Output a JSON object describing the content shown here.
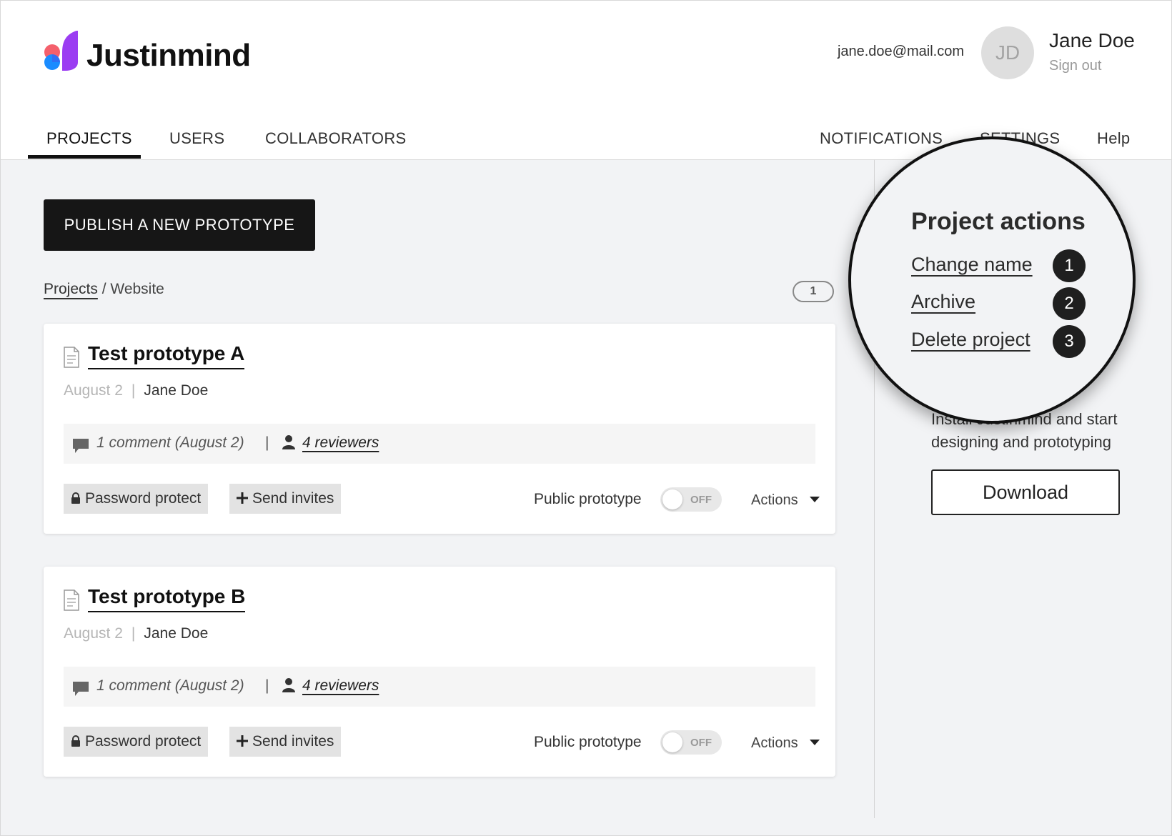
{
  "brand": {
    "name": "Justinmind"
  },
  "user": {
    "email": "jane.doe@mail.com",
    "initials": "JD",
    "name": "Jane Doe",
    "sign_out": "Sign out"
  },
  "nav": {
    "tabs": [
      {
        "label": "PROJECTS",
        "active": true
      },
      {
        "label": "USERS"
      },
      {
        "label": "COLLABORATORS"
      }
    ],
    "right_tabs": [
      {
        "label": "NOTIFICATIONS"
      },
      {
        "label": "SETTINGS"
      },
      {
        "label": "Help"
      }
    ]
  },
  "main": {
    "publish_label": "PUBLISH A NEW PROTOTYPE",
    "breadcrumb": {
      "root": "Projects",
      "current": "/ Website"
    },
    "count": "1",
    "cards": [
      {
        "title": "Test prototype A",
        "date": "August 2",
        "separator": "|",
        "author": "Jane Doe",
        "comment": "1 comment (August 2)",
        "bar_separator": "|",
        "reviewers": "4 reviewers",
        "password_label": "Password protect",
        "invite_label": "Send invites",
        "public_label": "Public prototype",
        "toggle_state": "OFF",
        "actions_label": "Actions"
      },
      {
        "title": "Test prototype B",
        "date": "August 2",
        "separator": "|",
        "author": "Jane Doe",
        "comment": "1 comment (August 2)",
        "bar_separator": "|",
        "reviewers": "4 reviewers",
        "password_label": "Password protect",
        "invite_label": "Send invites",
        "public_label": "Public prototype",
        "toggle_state": "OFF",
        "actions_label": "Actions"
      }
    ]
  },
  "sidebar": {
    "install_text": "Install Justinmind and start designing and prototyping",
    "download_label": "Download"
  },
  "callout": {
    "heading": "Project actions",
    "items": [
      {
        "label": "Change name",
        "number": "1"
      },
      {
        "label": "Archive",
        "number": "2"
      },
      {
        "label": "Delete project",
        "number": "3"
      }
    ]
  },
  "colors": {
    "primary": "#161616",
    "background": "#f2f3f5",
    "logo_pink": "#f4606c",
    "logo_blue": "#1a8cff",
    "logo_purple": "#9b3df2"
  }
}
